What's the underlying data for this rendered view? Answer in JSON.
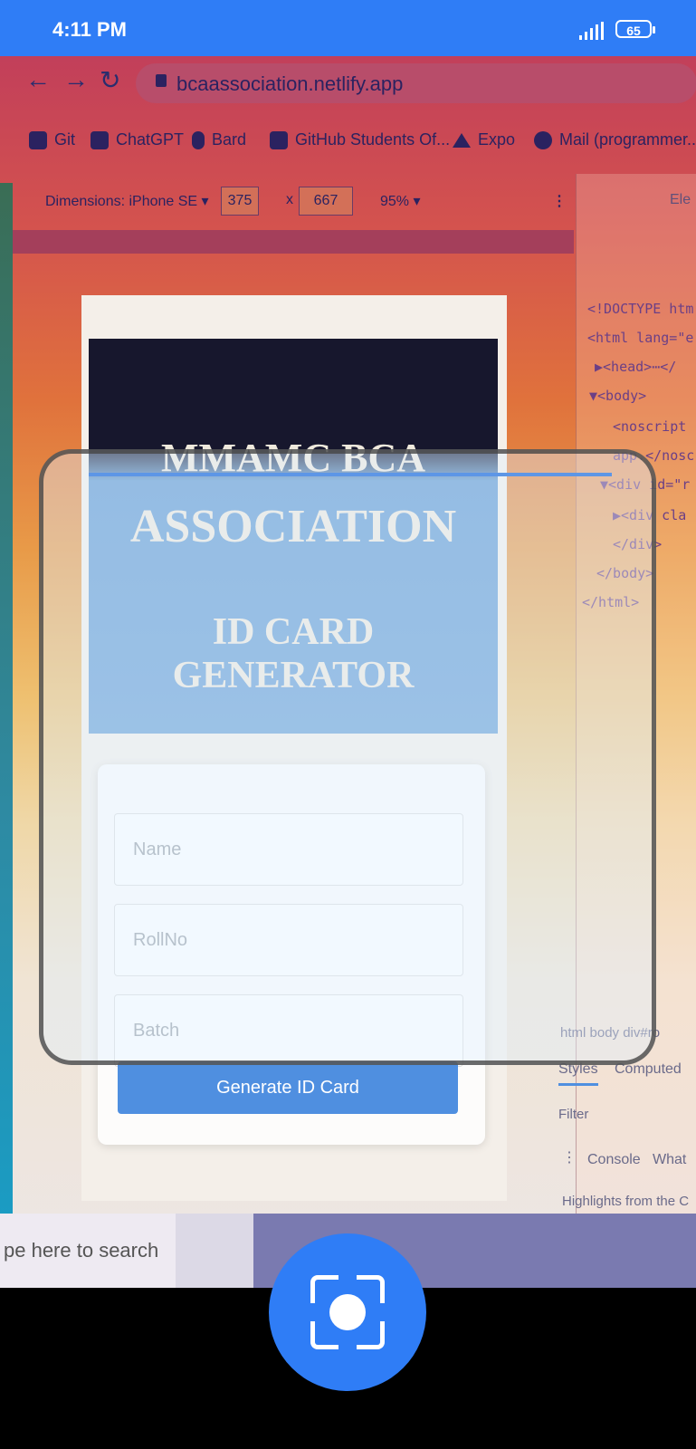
{
  "status_bar": {
    "time": "4:11 PM",
    "battery": "65"
  },
  "browser": {
    "url": "bcaassociation.netlify.app",
    "bookmarks": [
      "Git",
      "ChatGPT",
      "Bard",
      "GitHub Students Of...",
      "Expo",
      "Mail (programmer..."
    ],
    "devtools_toolbar": {
      "device": "Dimensions: iPhone SE ▾",
      "width": "375",
      "times": "x",
      "height": "667",
      "zoom": "95% ▾"
    },
    "devtools_panel": {
      "elements_tab": "Ele",
      "code_lines": [
        "<!DOCTYPE htm",
        "<html lang=\"e",
        "▶<head>⋯</",
        "▼<body>",
        "<noscript",
        "app.</nosc",
        "▼<div id=\"r",
        "▶<div cla",
        "</div>",
        "</body>",
        "</html>"
      ],
      "breadcrumb": "html  body  div#ro",
      "styles_tab": "Styles",
      "computed_tab": "Computed",
      "filter_label": "Filter",
      "console_tab": "Console",
      "whats_tab": "What",
      "highlights": "Highlights from the C"
    }
  },
  "page": {
    "title_line1": "MMAMC BCA",
    "title_line2": "ASSOCIATION",
    "subtitle": "ID CARD GENERATOR",
    "name_placeholder": "Name",
    "rollno_placeholder": "RollNo",
    "batch_placeholder": "Batch",
    "generate_button": "Generate ID Card"
  },
  "taskbar": {
    "search_text": "pe here to search"
  },
  "colors": {
    "status_bar": "#2f7df6",
    "capture_button": "#2f7df6",
    "scan_line": "#5d96e6"
  }
}
